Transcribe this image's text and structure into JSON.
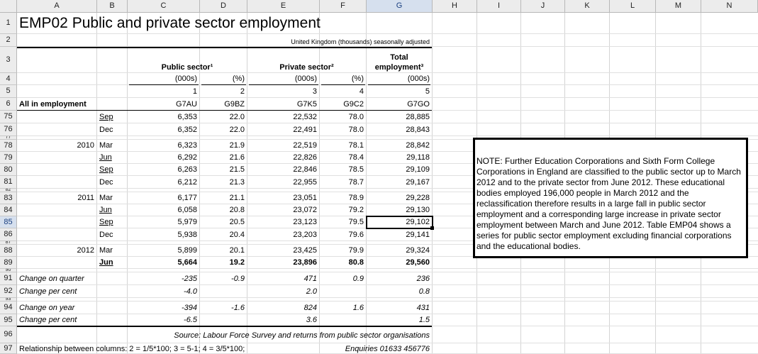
{
  "columns": [
    "A",
    "B",
    "C",
    "D",
    "E",
    "F",
    "G",
    "H",
    "I",
    "J",
    "K",
    "L",
    "M",
    "N"
  ],
  "selected_column": "G",
  "selected_row": "85",
  "title": "EMP02 Public and private sector employment",
  "subtitle": "United Kingdom (thousands) seasonally adjusted",
  "headers": {
    "total_employment": "Total",
    "public_sector": "Public sector¹",
    "private_sector": "Private sector²",
    "employment": "employment³",
    "units": [
      "(000s)",
      "(%)",
      "(000s)",
      "(%)",
      "(000s)"
    ],
    "numbers": [
      "1",
      "2",
      "3",
      "4",
      "5"
    ],
    "codes": [
      "G7AU",
      "G9BZ",
      "G7K5",
      "G9C2",
      "G7GO"
    ],
    "all_in_employment": "All in employment"
  },
  "rows": [
    {
      "rn": "75",
      "year": "",
      "month": "Sep",
      "u": true,
      "v": [
        "6,353",
        "22.0",
        "22,532",
        "78.0",
        "28,885"
      ]
    },
    {
      "rn": "76",
      "year": "",
      "month": "Dec",
      "u": false,
      "v": [
        "6,352",
        "22.0",
        "22,491",
        "78.0",
        "28,843"
      ]
    },
    {
      "rn": "78",
      "year": "2010",
      "month": "Mar",
      "u": false,
      "v": [
        "6,323",
        "21.9",
        "22,519",
        "78.1",
        "28,842"
      ]
    },
    {
      "rn": "79",
      "year": "",
      "month": "Jun",
      "u": true,
      "v": [
        "6,292",
        "21.6",
        "22,826",
        "78.4",
        "29,118"
      ]
    },
    {
      "rn": "80",
      "year": "",
      "month": "Sep",
      "u": true,
      "v": [
        "6,263",
        "21.5",
        "22,846",
        "78.5",
        "29,109"
      ]
    },
    {
      "rn": "81",
      "year": "",
      "month": "Dec",
      "u": false,
      "v": [
        "6,212",
        "21.3",
        "22,955",
        "78.7",
        "29,167"
      ]
    },
    {
      "rn": "83",
      "year": "2011",
      "month": "Mar",
      "u": false,
      "v": [
        "6,177",
        "21.1",
        "23,051",
        "78.9",
        "29,228"
      ]
    },
    {
      "rn": "84",
      "year": "",
      "month": "Jun",
      "u": true,
      "v": [
        "6,058",
        "20.8",
        "23,072",
        "79.2",
        "29,130"
      ]
    },
    {
      "rn": "85",
      "year": "",
      "month": "Sep",
      "u": true,
      "v": [
        "5,979",
        "20.5",
        "23,123",
        "79.5",
        "29,102"
      ]
    },
    {
      "rn": "86",
      "year": "",
      "month": "Dec",
      "u": false,
      "v": [
        "5,938",
        "20.4",
        "23,203",
        "79.6",
        "29,141"
      ]
    },
    {
      "rn": "88",
      "year": "2012",
      "month": "Mar",
      "u": false,
      "v": [
        "5,899",
        "20.1",
        "23,425",
        "79.9",
        "29,324"
      ]
    },
    {
      "rn": "89",
      "year": "",
      "month": "Jun",
      "u": true,
      "bold": true,
      "v": [
        "5,664",
        "19.2",
        "23,896",
        "80.8",
        "29,560"
      ]
    }
  ],
  "changes": [
    {
      "rn": "91",
      "label": "Change on quarter",
      "v": [
        "-235",
        "-0.9",
        "471",
        "0.9",
        "236"
      ]
    },
    {
      "rn": "92",
      "label": "Change per cent",
      "v": [
        "-4.0",
        "",
        "2.0",
        "",
        "0.8"
      ]
    },
    {
      "rn": "94",
      "label": "Change on year",
      "v": [
        "-394",
        "-1.6",
        "824",
        "1.6",
        "431"
      ]
    },
    {
      "rn": "95",
      "label": "Change per cent",
      "v": [
        "-6.5",
        "",
        "3.6",
        "",
        "1.5"
      ]
    }
  ],
  "source": "Source: Labour Force Survey and returns from public sector organisations",
  "relationship": "Relationship between columns: 2 = 1/5*100; 3 = 5-1; 4 = 3/5*100;",
  "enquiries": "Enquiries 01633 456776",
  "note": "NOTE: Further Education Corporations and Sixth Form College Corporations in England are classified to the public sector up to March 2012 and to the private sector from June 2012. These educational bodies employed 196,000 people in March 2012 and the reclassification therefore results in a large fall in public sector employment and a corresponding large increase in private sector employment between March and June 2012. Table EMP04 shows a series for public sector employment excluding financial corporations and the educational bodies."
}
